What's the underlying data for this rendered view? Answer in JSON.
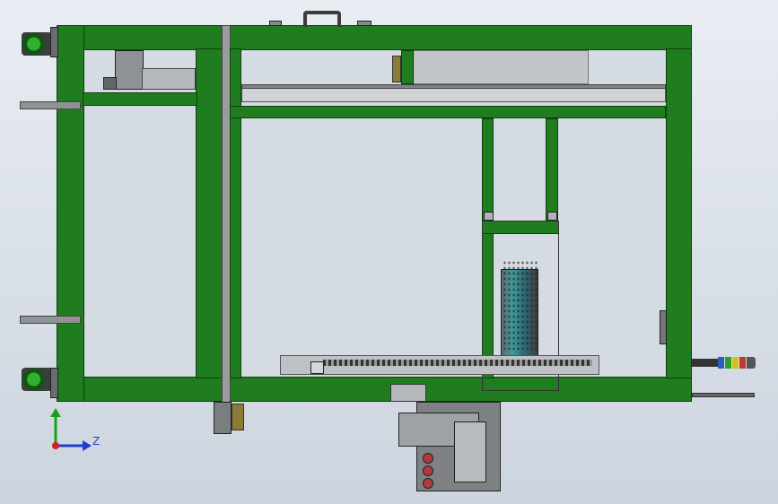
{
  "viewport": {
    "triad_axis_label": "Z"
  },
  "colors": {
    "frame_green": "#1f7d1f",
    "frame_outline": "#0e3f0e",
    "background_top": "#e9edf3",
    "background_bottom": "#ccd4de",
    "axis_y": "#1aa11a",
    "axis_z": "#1e3fcc",
    "axis_origin": "#cc2222",
    "signal_tower": [
      "#3b3b3b",
      "#2b5fbf",
      "#2aa12a",
      "#d2c21e",
      "#c0392b"
    ]
  },
  "icons": {
    "triad": "coordinate-triad-icon",
    "handle": "carry-handle-icon",
    "feet": "leveling-foot-icon",
    "signal": "signal-tower-icon"
  }
}
